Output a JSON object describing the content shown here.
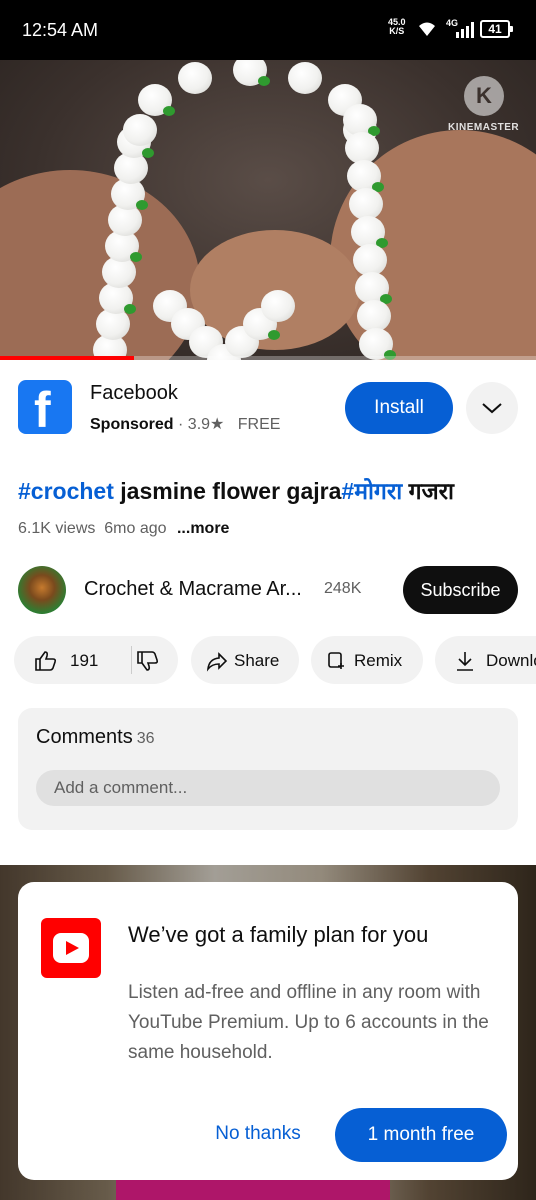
{
  "status_bar": {
    "time": "12:54 AM",
    "net_speed_value": "45.0",
    "net_speed_unit": "K/S",
    "network_type": "4G",
    "battery": "41"
  },
  "video": {
    "watermark_text": "KINEMASTER",
    "watermark_icon": "kinemaster-logo-icon",
    "progress_percent": 25
  },
  "ad": {
    "app_name": "Facebook",
    "sponsored_label": "Sponsored",
    "separator": "·",
    "rating": "3.9",
    "star": "★",
    "price": "FREE",
    "install_label": "Install",
    "logo_letter": "f"
  },
  "title": {
    "hashtag1": "#crochet",
    "text1": " jasmine flower gajra",
    "hashtag2": "#मोगरा",
    "text2": " गजरा"
  },
  "meta": {
    "views": "6.1K views",
    "age": "6mo ago",
    "more": "...more"
  },
  "channel": {
    "name": "Crochet & Macrame Ar...",
    "subscribers": "248K",
    "subscribe_label": "Subscribe"
  },
  "actions": {
    "likes": "191",
    "share_label": "Share",
    "remix_label": "Remix",
    "download_label": "Download"
  },
  "comments": {
    "title": "Comments",
    "count": "36",
    "placeholder": "Add a comment..."
  },
  "dialog": {
    "title": "We’ve got a family plan for you",
    "body": "Listen ad-free and offline in any room with YouTube Premium. Up to 6 accounts in the same household.",
    "no_thanks_label": "No thanks",
    "trial_label": "1 month free"
  },
  "colors": {
    "accent": "#065fd4",
    "facebook_blue": "#1877f2",
    "youtube_red": "#ff0000",
    "progress_red": "#ff0000",
    "status_bar_bg": "#000000"
  }
}
